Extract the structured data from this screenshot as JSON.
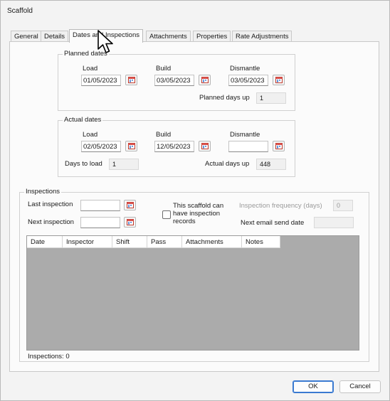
{
  "window": {
    "title": "Scaffold"
  },
  "tabs": [
    {
      "label": "General"
    },
    {
      "label": "Details"
    },
    {
      "label": "Dates and Inspections"
    },
    {
      "label": "Attachments"
    },
    {
      "label": "Properties"
    },
    {
      "label": "Rate Adjustments"
    }
  ],
  "planned": {
    "legend": "Planned dates",
    "load_label": "Load",
    "load_value": "01/05/2023",
    "build_label": "Build",
    "build_value": "03/05/2023",
    "dismantle_label": "Dismantle",
    "dismantle_value": "03/05/2023",
    "days_up_label": "Planned days up",
    "days_up_value": "1"
  },
  "actual": {
    "legend": "Actual dates",
    "load_label": "Load",
    "load_value": "02/05/2023",
    "build_label": "Build",
    "build_value": "12/05/2023",
    "dismantle_label": "Dismantle",
    "dismantle_value": "",
    "days_to_load_label": "Days to load",
    "days_to_load_value": "1",
    "days_up_label": "Actual days up",
    "days_up_value": "448"
  },
  "inspections": {
    "legend": "Inspections",
    "last_label": "Last inspection",
    "last_value": "",
    "next_label": "Next inspection",
    "next_value": "",
    "can_have_records_label": "This scaffold can have inspection records",
    "can_have_records_checked": false,
    "frequency_label": "Inspection frequency (days)",
    "frequency_value": "0",
    "next_email_label": "Next email send date",
    "next_email_value": "",
    "columns": [
      "Date",
      "Inspector",
      "Shift",
      "Pass",
      "Attachments",
      "Notes"
    ],
    "count_label": "Inspections: 0"
  },
  "buttons": {
    "ok": "OK",
    "cancel": "Cancel"
  },
  "colors": {
    "accent": "#3a7ad1",
    "grid_bg": "#ababab"
  }
}
